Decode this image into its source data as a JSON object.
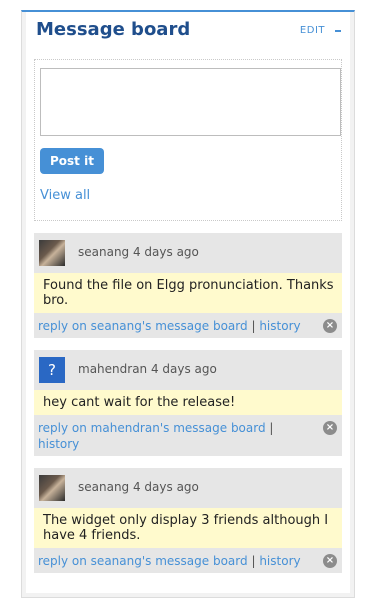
{
  "widget": {
    "title": "Message board",
    "edit_label": "EDIT",
    "collapse_icon": "minus-icon"
  },
  "post": {
    "textarea_value": "",
    "button_label": "Post it",
    "view_all_label": "View all"
  },
  "messages": [
    {
      "avatar": "user-photo",
      "meta": "seanang 4 days ago",
      "content": "Found the file on Elgg pronunciation. Thanks bro.",
      "reply_label": "reply on seanang's message board",
      "separator": "|",
      "history_label": "history",
      "delete_icon": "close-circle-icon"
    },
    {
      "avatar": "default-avatar",
      "avatar_glyph": "?",
      "meta": "mahendran 4 days ago",
      "content": "hey cant wait for the release!",
      "reply_label": "reply on mahendran's message board",
      "separator": "|",
      "history_label": "history",
      "delete_icon": "close-circle-icon"
    },
    {
      "avatar": "user-photo",
      "meta": "seanang 4 days ago",
      "content": "The widget only display 3 friends although I have 4 friends.",
      "reply_label": "reply on seanang's message board",
      "separator": "|",
      "history_label": "history",
      "delete_icon": "close-circle-icon"
    }
  ],
  "colors": {
    "accent": "#4690d6",
    "title": "#1f4e8c",
    "message_bg": "#e6e6e6",
    "content_bg": "#fffacd"
  }
}
